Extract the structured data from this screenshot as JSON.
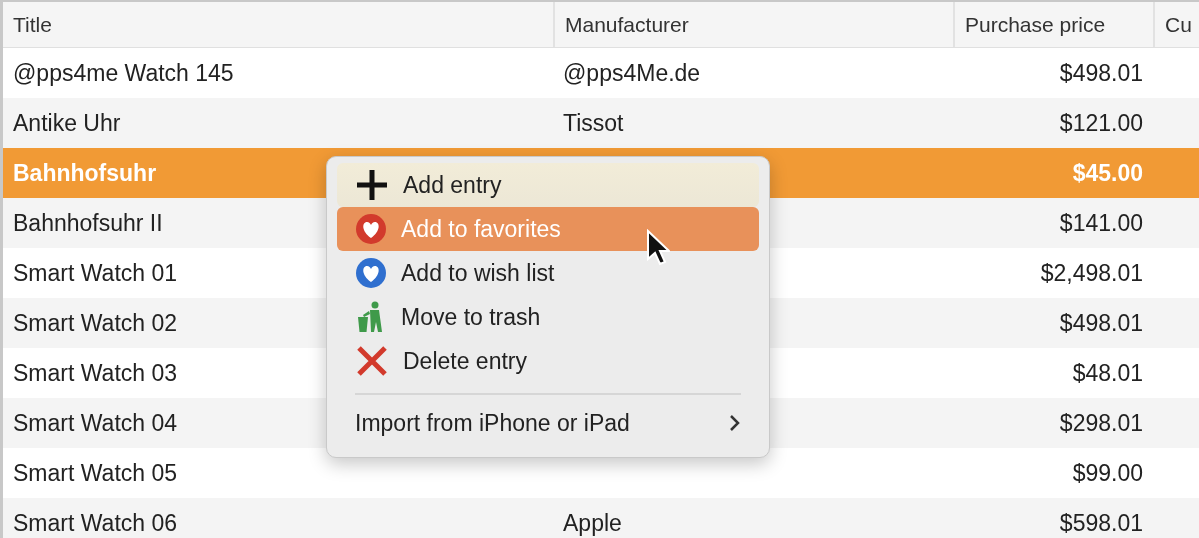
{
  "table": {
    "columns": [
      "Title",
      "Manufacturer",
      "Purchase price",
      "Cu"
    ],
    "rows": [
      {
        "title": "@pps4me Watch 145",
        "manufacturer": "@pps4Me.de",
        "price": "$498.01",
        "selected": false
      },
      {
        "title": "Antike Uhr",
        "manufacturer": "Tissot",
        "price": "$121.00",
        "selected": false
      },
      {
        "title": "Bahnhofsuhr",
        "price": "$45.00",
        "selected": true
      },
      {
        "title": "Bahnhofsuhr II",
        "price": "$141.00",
        "selected": false
      },
      {
        "title": "Smart Watch 01",
        "price": "$2,498.01",
        "selected": false
      },
      {
        "title": "Smart Watch 02",
        "price": "$498.01",
        "selected": false
      },
      {
        "title": "Smart Watch 03",
        "price": "$48.01",
        "selected": false
      },
      {
        "title": "Smart Watch 04",
        "price": "$298.01",
        "selected": false
      },
      {
        "title": "Smart Watch 05",
        "price": "$99.00",
        "selected": false
      },
      {
        "title": "Smart Watch 06",
        "manufacturer": "Apple",
        "price": "$598.01",
        "selected": false
      }
    ]
  },
  "context_menu": {
    "items": [
      {
        "kind": "add",
        "label": "Add entry",
        "selected": false
      },
      {
        "kind": "favorite",
        "label": "Add to favorites",
        "selected": true
      },
      {
        "kind": "wish",
        "label": "Add to wish list",
        "selected": false
      },
      {
        "kind": "trash",
        "label": "Move to trash",
        "selected": false
      },
      {
        "kind": "delete",
        "label": "Delete entry",
        "selected": false
      },
      {
        "kind": "submenu",
        "label": "Import from iPhone or iPad",
        "selected": false
      }
    ]
  }
}
